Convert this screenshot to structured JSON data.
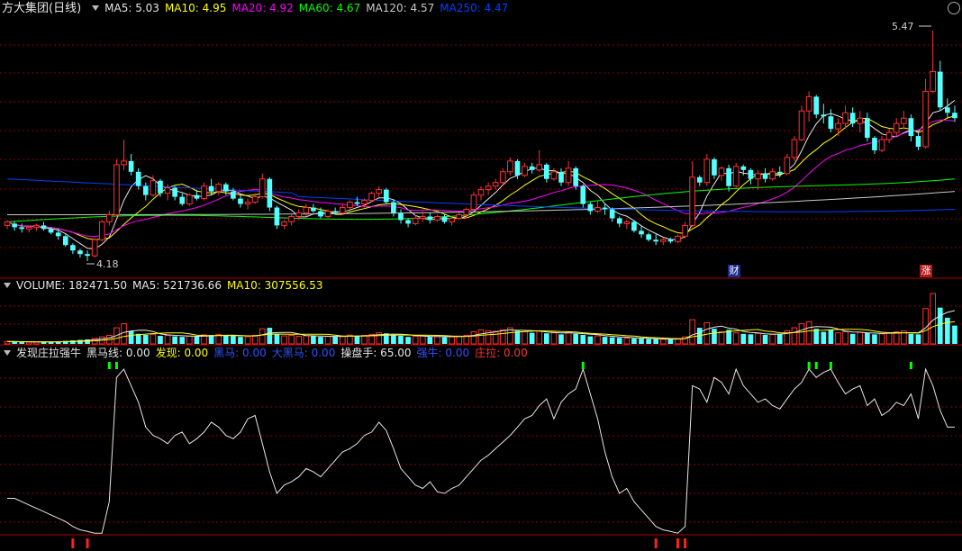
{
  "main": {
    "title": "方大集团(日线)",
    "ma": [
      {
        "label": "MA5: 5.03",
        "color": "#e6e6e6"
      },
      {
        "label": "MA10: 4.95",
        "color": "#ffff00"
      },
      {
        "label": "MA20: 4.92",
        "color": "#ff00ff"
      },
      {
        "label": "MA60: 4.67",
        "color": "#00ff00"
      },
      {
        "label": "MA120: 4.57",
        "color": "#c8c8c8"
      },
      {
        "label": "MA250: 4.47",
        "color": "#0040ff"
      }
    ],
    "high_label": "5.47",
    "low_label": "4.18",
    "tag_cai": "财",
    "tag_zhang": "涨"
  },
  "volume": {
    "labels": [
      {
        "label": "VOLUME: 182471.50",
        "color": "#e6e6e6"
      },
      {
        "label": "MA5: 521736.66",
        "color": "#e6e6e6"
      },
      {
        "label": "MA10: 307556.53",
        "color": "#ffff00"
      }
    ]
  },
  "indicator": {
    "labels": [
      {
        "label": "发现庄拉强牛",
        "color": "#e6e6e6"
      },
      {
        "label": "黑马线: 0.00",
        "color": "#e6e6e6"
      },
      {
        "label": "发现: 0.00",
        "color": "#ffff00"
      },
      {
        "label": "黑马: 0.00",
        "color": "#3050ff"
      },
      {
        "label": "大黑马: 0.00",
        "color": "#3050ff"
      },
      {
        "label": "操盘手: 65.00",
        "color": "#e6e6e6"
      },
      {
        "label": "强牛: 0.00",
        "color": "#3050ff"
      },
      {
        "label": "庄拉: 0.00",
        "color": "#ff3030"
      }
    ]
  },
  "colors": {
    "up": "#ff3232",
    "down": "#54ffff",
    "ma5": "#e6e6e6",
    "ma10": "#ffff00",
    "ma20": "#ff00ff",
    "ma60": "#00ff00",
    "ma120": "#c8c8c8",
    "ma250": "#0040ff",
    "grid": "#8b0000",
    "axis": "#b00000"
  },
  "chart_data": [
    {
      "type": "candlestick",
      "y_range": [
        4.1,
        5.55
      ],
      "candles": [
        [
          4.38,
          4.41,
          4.36,
          4.4
        ],
        [
          4.39,
          4.4,
          4.35,
          4.37
        ],
        [
          4.37,
          4.39,
          4.34,
          4.36
        ],
        [
          4.36,
          4.38,
          4.34,
          4.37
        ],
        [
          4.37,
          4.39,
          4.35,
          4.38
        ],
        [
          4.38,
          4.4,
          4.35,
          4.36
        ],
        [
          4.36,
          4.37,
          4.33,
          4.34
        ],
        [
          4.34,
          4.36,
          4.3,
          4.32
        ],
        [
          4.32,
          4.33,
          4.26,
          4.27
        ],
        [
          4.27,
          4.28,
          4.22,
          4.24
        ],
        [
          4.24,
          4.25,
          4.2,
          4.22
        ],
        [
          4.22,
          4.24,
          4.18,
          4.21
        ],
        [
          4.21,
          4.31,
          4.2,
          4.3
        ],
        [
          4.3,
          4.41,
          4.29,
          4.4
        ],
        [
          4.4,
          4.46,
          4.38,
          4.44
        ],
        [
          4.44,
          4.75,
          4.43,
          4.72
        ],
        [
          4.72,
          4.86,
          4.69,
          4.74
        ],
        [
          4.74,
          4.78,
          4.66,
          4.68
        ],
        [
          4.68,
          4.7,
          4.58,
          4.6
        ],
        [
          4.6,
          4.62,
          4.52,
          4.55
        ],
        [
          4.55,
          4.66,
          4.54,
          4.63
        ],
        [
          4.63,
          4.64,
          4.54,
          4.56
        ],
        [
          4.56,
          4.61,
          4.52,
          4.59
        ],
        [
          4.59,
          4.6,
          4.52,
          4.54
        ],
        [
          4.54,
          4.56,
          4.49,
          4.5
        ],
        [
          4.5,
          4.56,
          4.49,
          4.55
        ],
        [
          4.55,
          4.58,
          4.52,
          4.53
        ],
        [
          4.53,
          4.62,
          4.52,
          4.6
        ],
        [
          4.6,
          4.64,
          4.55,
          4.57
        ],
        [
          4.57,
          4.62,
          4.55,
          4.61
        ],
        [
          4.61,
          4.62,
          4.55,
          4.57
        ],
        [
          4.57,
          4.59,
          4.52,
          4.53
        ],
        [
          4.53,
          4.55,
          4.48,
          4.5
        ],
        [
          4.5,
          4.53,
          4.47,
          4.51
        ],
        [
          4.51,
          4.56,
          4.5,
          4.54
        ],
        [
          4.54,
          4.67,
          4.53,
          4.64
        ],
        [
          4.64,
          4.65,
          4.46,
          4.48
        ],
        [
          4.48,
          4.49,
          4.36,
          4.38
        ],
        [
          4.38,
          4.41,
          4.36,
          4.4
        ],
        [
          4.4,
          4.45,
          4.38,
          4.43
        ],
        [
          4.43,
          4.47,
          4.41,
          4.45
        ],
        [
          4.45,
          4.5,
          4.43,
          4.48
        ],
        [
          4.48,
          4.5,
          4.45,
          4.46
        ],
        [
          4.46,
          4.48,
          4.42,
          4.43
        ],
        [
          4.43,
          4.47,
          4.42,
          4.46
        ],
        [
          4.46,
          4.48,
          4.44,
          4.45
        ],
        [
          4.45,
          4.5,
          4.44,
          4.48
        ],
        [
          4.48,
          4.52,
          4.47,
          4.51
        ],
        [
          4.51,
          4.54,
          4.49,
          4.5
        ],
        [
          4.5,
          4.53,
          4.48,
          4.52
        ],
        [
          4.52,
          4.57,
          4.51,
          4.56
        ],
        [
          4.56,
          4.6,
          4.54,
          4.58
        ],
        [
          4.58,
          4.59,
          4.5,
          4.51
        ],
        [
          4.51,
          4.52,
          4.43,
          4.45
        ],
        [
          4.45,
          4.47,
          4.39,
          4.41
        ],
        [
          4.41,
          4.42,
          4.37,
          4.39
        ],
        [
          4.39,
          4.44,
          4.38,
          4.42
        ],
        [
          4.42,
          4.46,
          4.4,
          4.43
        ],
        [
          4.43,
          4.45,
          4.39,
          4.41
        ],
        [
          4.41,
          4.44,
          4.4,
          4.43
        ],
        [
          4.43,
          4.44,
          4.39,
          4.4
        ],
        [
          4.4,
          4.43,
          4.38,
          4.42
        ],
        [
          4.42,
          4.45,
          4.41,
          4.44
        ],
        [
          4.44,
          4.48,
          4.42,
          4.47
        ],
        [
          4.47,
          4.57,
          4.46,
          4.55
        ],
        [
          4.55,
          4.6,
          4.52,
          4.58
        ],
        [
          4.58,
          4.62,
          4.55,
          4.6
        ],
        [
          4.6,
          4.64,
          4.58,
          4.62
        ],
        [
          4.62,
          4.7,
          4.6,
          4.68
        ],
        [
          4.68,
          4.76,
          4.66,
          4.74
        ],
        [
          4.74,
          4.75,
          4.64,
          4.66
        ],
        [
          4.66,
          4.73,
          4.65,
          4.71
        ],
        [
          4.71,
          4.73,
          4.67,
          4.69
        ],
        [
          4.69,
          4.8,
          4.68,
          4.72
        ],
        [
          4.72,
          4.73,
          4.62,
          4.64
        ],
        [
          4.64,
          4.7,
          4.63,
          4.68
        ],
        [
          4.68,
          4.7,
          4.6,
          4.62
        ],
        [
          4.62,
          4.74,
          4.6,
          4.7
        ],
        [
          4.7,
          4.71,
          4.58,
          4.6
        ],
        [
          4.6,
          4.61,
          4.48,
          4.5
        ],
        [
          4.5,
          4.51,
          4.44,
          4.46
        ],
        [
          4.46,
          4.52,
          4.45,
          4.48
        ],
        [
          4.48,
          4.5,
          4.44,
          4.47
        ],
        [
          4.47,
          4.48,
          4.4,
          4.42
        ],
        [
          4.42,
          4.43,
          4.37,
          4.39
        ],
        [
          4.39,
          4.41,
          4.36,
          4.4
        ],
        [
          4.4,
          4.41,
          4.34,
          4.35
        ],
        [
          4.35,
          4.38,
          4.31,
          4.33
        ],
        [
          4.33,
          4.34,
          4.29,
          4.3
        ],
        [
          4.3,
          4.33,
          4.27,
          4.29
        ],
        [
          4.29,
          4.31,
          4.27,
          4.3
        ],
        [
          4.3,
          4.31,
          4.28,
          4.29
        ],
        [
          4.29,
          4.33,
          4.28,
          4.32
        ],
        [
          4.32,
          4.4,
          4.31,
          4.38
        ],
        [
          4.38,
          4.74,
          4.37,
          4.65
        ],
        [
          4.65,
          4.66,
          4.6,
          4.62
        ],
        [
          4.62,
          4.78,
          4.6,
          4.75
        ],
        [
          4.75,
          4.76,
          4.64,
          4.66
        ],
        [
          4.66,
          4.71,
          4.63,
          4.7
        ],
        [
          4.7,
          4.72,
          4.57,
          4.6
        ],
        [
          4.6,
          4.73,
          4.59,
          4.71
        ],
        [
          4.71,
          4.72,
          4.66,
          4.69
        ],
        [
          4.69,
          4.7,
          4.61,
          4.64
        ],
        [
          4.64,
          4.69,
          4.58,
          4.67
        ],
        [
          4.67,
          4.7,
          4.62,
          4.64
        ],
        [
          4.64,
          4.7,
          4.63,
          4.68
        ],
        [
          4.68,
          4.71,
          4.65,
          4.67
        ],
        [
          4.67,
          4.78,
          4.66,
          4.76
        ],
        [
          4.76,
          4.88,
          4.74,
          4.86
        ],
        [
          4.86,
          5.05,
          4.85,
          5.02
        ],
        [
          5.02,
          5.13,
          4.96,
          5.1
        ],
        [
          5.1,
          5.11,
          4.98,
          5.0
        ],
        [
          5.0,
          5.06,
          4.95,
          4.99
        ],
        [
          4.99,
          5.03,
          4.9,
          4.92
        ],
        [
          4.92,
          4.98,
          4.88,
          4.95
        ],
        [
          4.95,
          5.05,
          4.92,
          5.01
        ],
        [
          5.01,
          5.04,
          4.93,
          4.95
        ],
        [
          4.95,
          5.02,
          4.9,
          4.98
        ],
        [
          4.98,
          5.01,
          4.85,
          4.87
        ],
        [
          4.87,
          4.88,
          4.78,
          4.8
        ],
        [
          4.8,
          4.88,
          4.79,
          4.86
        ],
        [
          4.86,
          4.92,
          4.84,
          4.9
        ],
        [
          4.9,
          4.98,
          4.88,
          4.95
        ],
        [
          4.95,
          5.02,
          4.92,
          4.98
        ],
        [
          4.98,
          5.0,
          4.85,
          4.88
        ],
        [
          4.88,
          4.9,
          4.8,
          4.82
        ],
        [
          4.82,
          5.2,
          4.81,
          5.13
        ],
        [
          5.13,
          5.47,
          5.12,
          5.24
        ],
        [
          5.24,
          5.3,
          5.02,
          5.04
        ],
        [
          5.04,
          5.09,
          4.98,
          5.01
        ],
        [
          5.01,
          5.05,
          4.96,
          4.98
        ]
      ]
    },
    {
      "type": "bar",
      "name": "VOLUME",
      "values": [
        25,
        22,
        20,
        18,
        19,
        22,
        20,
        24,
        30,
        35,
        40,
        45,
        55,
        70,
        85,
        160,
        200,
        130,
        100,
        90,
        95,
        80,
        85,
        75,
        70,
        78,
        72,
        90,
        88,
        95,
        85,
        80,
        70,
        72,
        85,
        150,
        160,
        95,
        80,
        85,
        75,
        82,
        78,
        70,
        74,
        72,
        78,
        88,
        80,
        85,
        95,
        110,
        105,
        90,
        80,
        70,
        75,
        80,
        70,
        72,
        68,
        72,
        78,
        85,
        120,
        140,
        130,
        125,
        140,
        160,
        130,
        120,
        110,
        125,
        105,
        110,
        95,
        120,
        100,
        90,
        75,
        80,
        70,
        65,
        60,
        58,
        55,
        52,
        50,
        48,
        46,
        45,
        50,
        70,
        240,
        160,
        210,
        150,
        120,
        140,
        110,
        100,
        95,
        105,
        90,
        95,
        100,
        130,
        160,
        200,
        220,
        150,
        120,
        140,
        110,
        120,
        100,
        115,
        110,
        95,
        100,
        110,
        120,
        130,
        100,
        95,
        350,
        500,
        360,
        260,
        182
      ]
    },
    {
      "type": "line",
      "name": "操盘手",
      "y_range": [
        0,
        100
      ],
      "values": [
        22,
        22,
        20,
        18,
        16,
        14,
        12,
        10,
        8,
        5,
        3,
        2,
        1,
        1,
        20,
        95,
        100,
        90,
        80,
        65,
        60,
        58,
        55,
        60,
        62,
        55,
        58,
        62,
        68,
        65,
        60,
        58,
        62,
        70,
        72,
        55,
        38,
        25,
        30,
        32,
        35,
        40,
        38,
        35,
        40,
        45,
        50,
        52,
        55,
        60,
        62,
        68,
        63,
        52,
        40,
        35,
        30,
        28,
        32,
        26,
        25,
        28,
        30,
        35,
        40,
        45,
        48,
        52,
        56,
        60,
        65,
        70,
        72,
        78,
        82,
        70,
        80,
        85,
        88,
        100,
        85,
        70,
        50,
        35,
        25,
        28,
        20,
        15,
        10,
        5,
        3,
        2,
        1,
        5,
        90,
        88,
        80,
        95,
        92,
        85,
        100,
        90,
        85,
        80,
        82,
        78,
        76,
        82,
        88,
        92,
        100,
        95,
        98,
        100,
        92,
        85,
        88,
        90,
        78,
        82,
        72,
        75,
        80,
        78,
        85,
        70,
        100,
        90,
        75,
        65,
        65
      ],
      "signals_top": [
        14,
        15,
        79,
        110,
        111,
        113,
        124
      ],
      "signals_bottom": [
        9,
        11,
        89,
        92,
        93
      ]
    }
  ]
}
